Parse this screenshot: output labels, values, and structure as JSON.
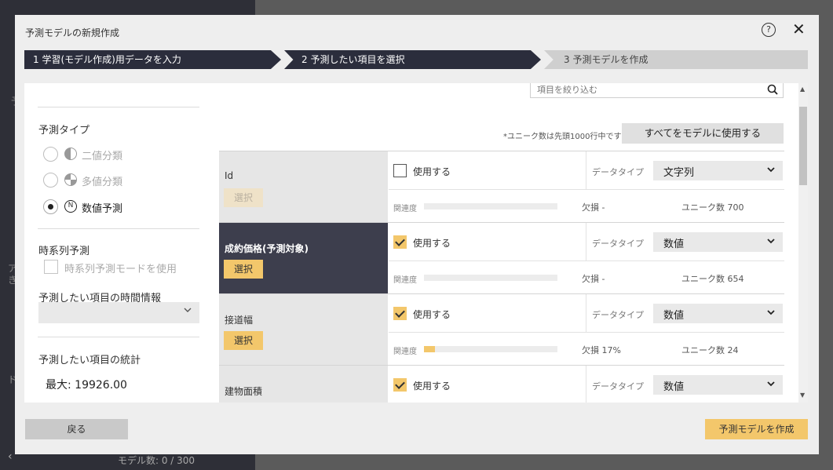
{
  "background": {
    "footer_text": "モデル数: 0 / 300",
    "left_stubs": [
      "予",
      "ア",
      "き",
      "ド"
    ]
  },
  "dialog": {
    "title": "予測モデルの新規作成",
    "help_glyph": "?",
    "close_glyph": "✕"
  },
  "steps": [
    {
      "label": "1 学習(モデル作成)用データを入力",
      "state": "done"
    },
    {
      "label": "2 予測したい項目を選択",
      "state": "active"
    },
    {
      "label": "3 予測モデルを作成",
      "state": "pending"
    }
  ],
  "left": {
    "prediction_type_heading": "予測タイプ",
    "prediction_types": [
      {
        "label": "二値分類",
        "selected": false,
        "icon": "half-circle-icon"
      },
      {
        "label": "多値分類",
        "selected": false,
        "icon": "pie-icon"
      },
      {
        "label": "数値予測",
        "selected": true,
        "icon": "numeric-icon"
      }
    ],
    "timeseries_heading": "時系列予測",
    "timeseries_option": "時系列予測モードを使用",
    "time_info_heading": "予測したい項目の時間情報",
    "time_info_value": "",
    "stats_heading": "予測したい項目の統計",
    "stats_max": "最大: 19926.00"
  },
  "search": {
    "placeholder": "項目を絞り込む",
    "icon": "search-icon"
  },
  "note": "*ユニーク数は先頭1000行中です",
  "use_all_button": "すべてをモデルに使用する",
  "labels": {
    "use": "使用する",
    "data_type": "データタイプ",
    "relevance": "関連度",
    "select": "選択"
  },
  "columns": [
    {
      "name": "Id",
      "target": false,
      "select_enabled": false,
      "used": false,
      "data_type": "文字列",
      "relevance": 0,
      "missing": "欠損 -",
      "unique": "ユニーク数 700"
    },
    {
      "name": "成約価格(予測対象)",
      "target": true,
      "select_enabled": true,
      "used": true,
      "data_type": "数値",
      "relevance": 0,
      "missing": "欠損 -",
      "unique": "ユニーク数 654"
    },
    {
      "name": "接道幅",
      "target": false,
      "select_enabled": true,
      "used": true,
      "data_type": "数値",
      "relevance": 0.08,
      "missing": "欠損 17%",
      "unique": "ユニーク数 24"
    },
    {
      "name": "建物面積",
      "target": false,
      "select_enabled": true,
      "used": true,
      "data_type": "数値",
      "relevance": null,
      "missing": "",
      "unique": ""
    }
  ],
  "footer": {
    "back_button": "戻る",
    "create_button": "予測モデルを作成"
  },
  "colors": {
    "accent": "#f3c76b",
    "step_active": "#2b2d3c",
    "step_pending": "#cfcfcf",
    "selected_row": "#3d3e4d"
  }
}
